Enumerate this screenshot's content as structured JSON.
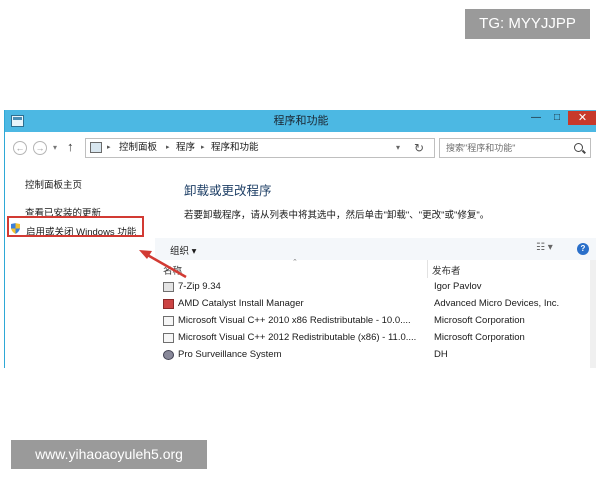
{
  "watermarks": {
    "top": "TG: MYYJJPP",
    "bottom": "www.yihaoaoyuleh5.org"
  },
  "window": {
    "title": "程序和功能",
    "buttons": {
      "minimize": "—",
      "maximize": "□",
      "close": "✕"
    }
  },
  "address_bar": {
    "back_glyph": "←",
    "forward_glyph": "→",
    "history_glyph": "▾",
    "up_glyph": "↑",
    "breadcrumb": [
      "控制面板",
      "程序",
      "程序和功能"
    ],
    "separator_glyph": "▸",
    "dropdown_glyph": "▾",
    "refresh_glyph": "↻",
    "search_placeholder": "搜索\"程序和功能\""
  },
  "nav_pane": {
    "home_link": "控制面板主页",
    "updates_link": "查看已安装的更新",
    "features_link": "启用或关闭 Windows 功能"
  },
  "content": {
    "title": "卸载或更改程序",
    "description": "若要卸载程序，请从列表中将其选中，然后单击\"卸载\"、\"更改\"或\"修复\"。",
    "toolbar": {
      "organize": "组织 ▾",
      "view": "☷ ▾",
      "help": "?"
    },
    "columns": {
      "name": "名称",
      "publisher": "发布者",
      "sort_glyph": "⌃"
    },
    "programs": [
      {
        "name": "7-Zip 9.34",
        "publisher": "Igor Pavlov",
        "icon": "seven-zip-icon"
      },
      {
        "name": "AMD Catalyst Install Manager",
        "publisher": "Advanced Micro Devices, Inc.",
        "icon": "amd-icon"
      },
      {
        "name": "Microsoft Visual C++ 2010  x86 Redistributable - 10.0....",
        "publisher": "Microsoft Corporation",
        "icon": "installer-icon"
      },
      {
        "name": "Microsoft Visual C++ 2012 Redistributable (x86) - 11.0....",
        "publisher": "Microsoft Corporation",
        "icon": "installer-icon"
      },
      {
        "name": "Pro Surveillance System",
        "publisher": "DH",
        "icon": "camera-icon"
      }
    ]
  },
  "colors": {
    "titlebar": "#4cb8e3",
    "highlight": "#d23a33",
    "close": "#c7392b",
    "heading": "#1e3f66"
  }
}
